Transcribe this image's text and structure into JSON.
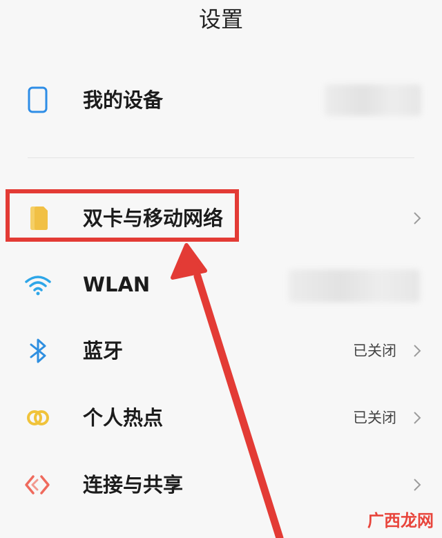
{
  "header": {
    "title": "设置"
  },
  "rows": {
    "my_device": {
      "label": "我的设备"
    },
    "dual_sim": {
      "label": "双卡与移动网络"
    },
    "wlan": {
      "label": "WLAN"
    },
    "bluetooth": {
      "label": "蓝牙",
      "status": "已关闭"
    },
    "hotspot": {
      "label": "个人热点",
      "status": "已关闭"
    },
    "connection_sharing": {
      "label": "连接与共享"
    }
  },
  "watermark": "广西龙网",
  "colors": {
    "background": "#f7f7f7",
    "annotation_red": "#e33b35",
    "device_icon": "#2e8de6",
    "sim_icon": "#f1c045",
    "wifi_icon": "#2ea6e8",
    "bluetooth_icon": "#2f8fe0",
    "hotspot_icon": "#f0c33b",
    "share_icon": "#ef6a5d"
  },
  "icons": {
    "my_device": "phone-icon",
    "dual_sim": "sim-card-icon",
    "wlan": "wifi-icon",
    "bluetooth": "bluetooth-icon",
    "hotspot": "hotspot-icon",
    "connection_sharing": "share-connection-icon"
  }
}
